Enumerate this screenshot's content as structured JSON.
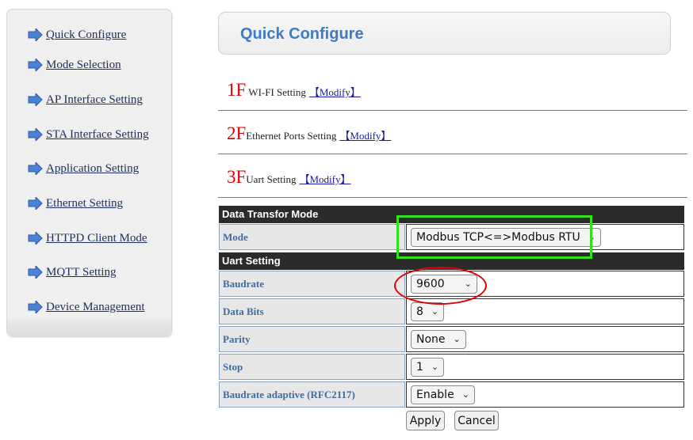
{
  "sidebar": {
    "items": [
      {
        "label": "Quick Configure"
      },
      {
        "label": "Mode Selection"
      },
      {
        "label": "AP Interface Setting"
      },
      {
        "label": "STA Interface Setting"
      },
      {
        "label": "Application Setting"
      },
      {
        "label": "Ethernet Setting"
      },
      {
        "label": "HTTPD Client Mode"
      },
      {
        "label": "MQTT Setting"
      },
      {
        "label": "Device Management"
      }
    ],
    "arrow_icon": "arrow-right-icon",
    "arrow_color": "#4a82d6"
  },
  "header": {
    "title": "Quick Configure",
    "title_color": "#3d7bc4"
  },
  "steps": [
    {
      "num": "1F",
      "label": "WI-FI Setting",
      "link": "【Modify】"
    },
    {
      "num": "2F",
      "label": "Ethernet Ports Setting",
      "link": "【Modify】"
    },
    {
      "num": "3F",
      "label": "Uart Setting",
      "link": "【Modify】"
    }
  ],
  "data_transfer": {
    "heading": "Data Transfor Mode",
    "mode_label": "Mode",
    "mode_value": "Modbus TCP<=>Modbus RTU"
  },
  "uart": {
    "heading": "Uart Setting",
    "baudrate_label": "Baudrate",
    "baudrate_value": "9600",
    "databits_label": "Data Bits",
    "databits_value": "8",
    "parity_label": "Parity",
    "parity_value": "None",
    "stop_label": "Stop",
    "stop_value": "1",
    "adaptive_label": "Baudrate adaptive (RFC2117)",
    "adaptive_value": "Enable"
  },
  "buttons": {
    "apply": "Apply",
    "cancel": "Cancel"
  },
  "annotations": {
    "green_box_color": "#2fe21b",
    "red_ellipse_color": "#e00000"
  }
}
